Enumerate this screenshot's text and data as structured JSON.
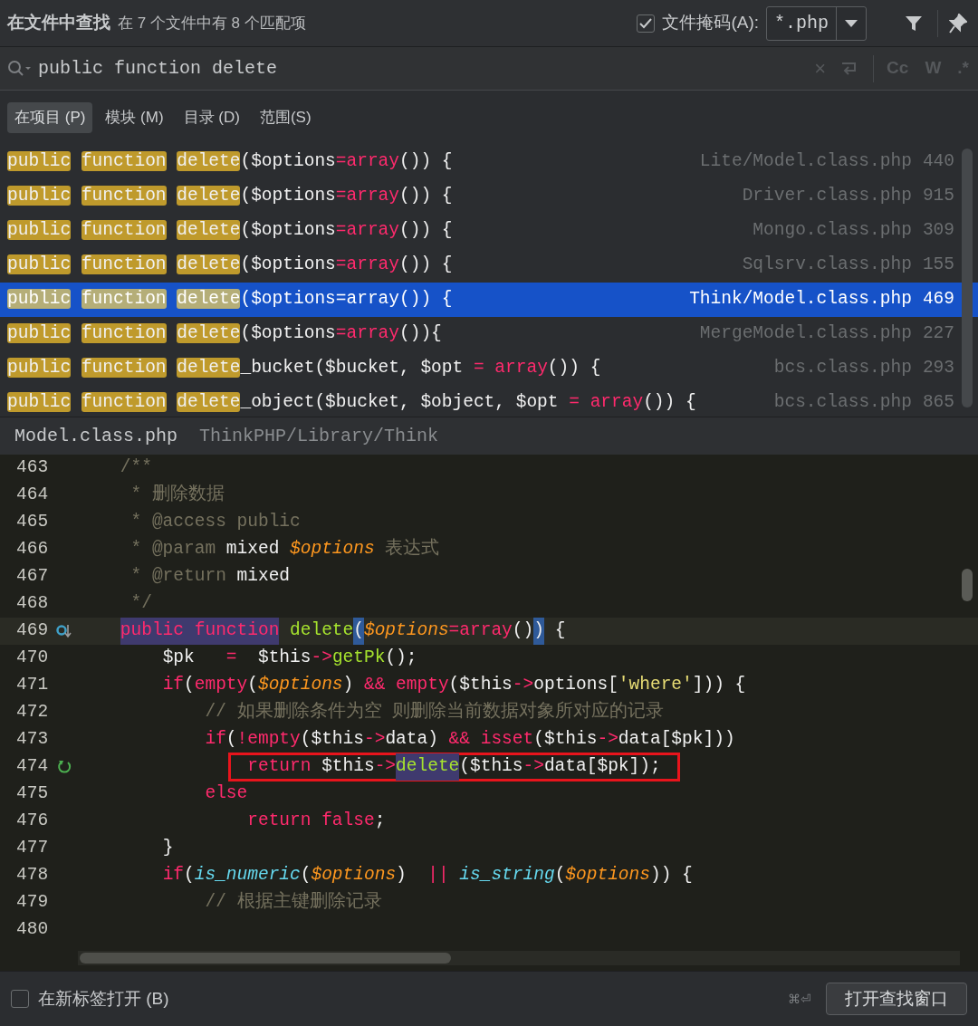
{
  "header": {
    "title": "在文件中查找",
    "summary": "在 7 个文件中有 8 个匹配项",
    "file_mask": {
      "checked": true,
      "label": "文件掩码(A):",
      "value": "*.php"
    }
  },
  "search": {
    "value": "public function delete",
    "clear": "×",
    "options": [
      {
        "label": "Cc",
        "on": false
      },
      {
        "label": "W",
        "on": false
      },
      {
        "label": ".*",
        "on": false
      }
    ]
  },
  "scopes": [
    {
      "label": "在项目 (P)",
      "selected": true
    },
    {
      "label": "模块 (M)",
      "selected": false
    },
    {
      "label": "目录 (D)",
      "selected": false
    },
    {
      "label": "范围(S)",
      "selected": false
    }
  ],
  "results": [
    {
      "selected": false,
      "file": "Lite/Model.class.php",
      "line": "440",
      "tokens": [
        {
          "t": "public",
          "kind": "match"
        },
        {
          "t": " function",
          "kind": "match"
        },
        {
          "t": " delete",
          "kind": "match"
        },
        {
          "t": "($options",
          "kind": "plain"
        },
        {
          "t": "=array",
          "kind": "kw"
        },
        {
          "t": "()) {",
          "kind": "plain"
        }
      ]
    },
    {
      "selected": false,
      "file": "Driver.class.php",
      "line": "915",
      "tokens": [
        {
          "t": "public",
          "kind": "match"
        },
        {
          "t": " function",
          "kind": "match"
        },
        {
          "t": " delete",
          "kind": "match"
        },
        {
          "t": "($options",
          "kind": "plain"
        },
        {
          "t": "=array",
          "kind": "kw"
        },
        {
          "t": "()) {",
          "kind": "plain"
        }
      ]
    },
    {
      "selected": false,
      "file": "Mongo.class.php",
      "line": "309",
      "tokens": [
        {
          "t": "public",
          "kind": "match"
        },
        {
          "t": " function",
          "kind": "match"
        },
        {
          "t": " delete",
          "kind": "match"
        },
        {
          "t": "($options",
          "kind": "plain"
        },
        {
          "t": "=array",
          "kind": "kw"
        },
        {
          "t": "()) {",
          "kind": "plain"
        }
      ]
    },
    {
      "selected": false,
      "file": "Sqlsrv.class.php",
      "line": "155",
      "tokens": [
        {
          "t": "public",
          "kind": "match"
        },
        {
          "t": " function",
          "kind": "match"
        },
        {
          "t": " delete",
          "kind": "match"
        },
        {
          "t": "($options",
          "kind": "plain"
        },
        {
          "t": "=array",
          "kind": "kw"
        },
        {
          "t": "()) {",
          "kind": "plain"
        }
      ]
    },
    {
      "selected": true,
      "file": "Think/Model.class.php",
      "line": "469",
      "tokens": [
        {
          "t": "public",
          "kind": "match"
        },
        {
          "t": " function",
          "kind": "match"
        },
        {
          "t": " delete",
          "kind": "match"
        },
        {
          "t": "($options",
          "kind": "plain"
        },
        {
          "t": "=array",
          "kind": "kw"
        },
        {
          "t": "()) {",
          "kind": "plain"
        }
      ]
    },
    {
      "selected": false,
      "file": "MergeModel.class.php",
      "line": "227",
      "tokens": [
        {
          "t": "public",
          "kind": "match"
        },
        {
          "t": " function",
          "kind": "match"
        },
        {
          "t": " delete",
          "kind": "match"
        },
        {
          "t": "($options",
          "kind": "plain"
        },
        {
          "t": "=array",
          "kind": "kw"
        },
        {
          "t": "()){",
          "kind": "plain"
        }
      ]
    },
    {
      "selected": false,
      "file": "bcs.class.php",
      "line": "293",
      "tokens": [
        {
          "t": "public",
          "kind": "match"
        },
        {
          "t": " function",
          "kind": "match"
        },
        {
          "t": " delete",
          "kind": "match"
        },
        {
          "t": "_bucket($bucket, $opt ",
          "kind": "plain"
        },
        {
          "t": "= array",
          "kind": "kw"
        },
        {
          "t": "()) {",
          "kind": "plain"
        }
      ]
    },
    {
      "selected": false,
      "file": "bcs.class.php",
      "line": "865",
      "tokens": [
        {
          "t": "public",
          "kind": "match"
        },
        {
          "t": " function",
          "kind": "match"
        },
        {
          "t": " delete",
          "kind": "match"
        },
        {
          "t": "_object($bucket, $object, $opt ",
          "kind": "plain"
        },
        {
          "t": "= array",
          "kind": "kw"
        },
        {
          "t": "()) {",
          "kind": "plain"
        }
      ]
    }
  ],
  "preview": {
    "file": "Model.class.php",
    "path": "ThinkPHP/Library/Think",
    "lines": [
      {
        "n": "463",
        "tokens": [
          {
            "t": "    /**",
            "kind": "comment"
          }
        ]
      },
      {
        "n": "464",
        "tokens": [
          {
            "t": "     * 删除数据",
            "kind": "comment"
          }
        ]
      },
      {
        "n": "465",
        "tokens": [
          {
            "t": "     * @access public",
            "kind": "comment"
          }
        ]
      },
      {
        "n": "466",
        "tokens": [
          {
            "t": "     * @param",
            "kind": "comment"
          },
          {
            "t": " mixed ",
            "kind": "plain"
          },
          {
            "t": "$options",
            "kind": "var"
          },
          {
            "t": " 表达式",
            "kind": "comment"
          }
        ]
      },
      {
        "n": "467",
        "tokens": [
          {
            "t": "     * @return",
            "kind": "comment"
          },
          {
            "t": " mixed",
            "kind": "plain"
          }
        ]
      },
      {
        "n": "468",
        "tokens": [
          {
            "t": "     */",
            "kind": "comment"
          }
        ]
      },
      {
        "n": "469",
        "current": true,
        "gutter_icon": {
          "kind": "override"
        },
        "tokens": [
          {
            "t": "    public function",
            "kind": "kw",
            "usage_highlight": true
          },
          {
            "t": " delete",
            "kind": "func"
          },
          {
            "t": "(",
            "kind": "plain",
            "brace_match": true
          },
          {
            "t": "$options",
            "kind": "var"
          },
          {
            "t": "=array",
            "kind": "kw"
          },
          {
            "t": "()",
            "kind": "plain"
          },
          {
            "t": ")",
            "kind": "plain",
            "brace_match": true
          },
          {
            "t": " {",
            "kind": "plain"
          }
        ]
      },
      {
        "n": "470",
        "tokens": [
          {
            "t": "        $pk   ",
            "kind": "plain"
          },
          {
            "t": "=",
            "kind": "kw"
          },
          {
            "t": "  $this",
            "kind": "plain"
          },
          {
            "t": "->",
            "kind": "kw"
          },
          {
            "t": "getPk",
            "kind": "func"
          },
          {
            "t": "();",
            "kind": "plain"
          }
        ]
      },
      {
        "n": "471",
        "tokens": [
          {
            "t": "        if",
            "kind": "kw"
          },
          {
            "t": "(",
            "kind": "plain"
          },
          {
            "t": "empty",
            "kind": "kw"
          },
          {
            "t": "(",
            "kind": "plain"
          },
          {
            "t": "$options",
            "kind": "var"
          },
          {
            "t": ") ",
            "kind": "plain"
          },
          {
            "t": "&& empty",
            "kind": "kw"
          },
          {
            "t": "($this",
            "kind": "plain"
          },
          {
            "t": "->",
            "kind": "kw"
          },
          {
            "t": "options[",
            "kind": "plain"
          },
          {
            "t": "'where'",
            "kind": "string"
          },
          {
            "t": "])) {",
            "kind": "plain"
          }
        ]
      },
      {
        "n": "472",
        "tokens": [
          {
            "t": "            // 如果删除条件为空 则删除当前数据对象所对应的记录",
            "kind": "comment"
          }
        ]
      },
      {
        "n": "473",
        "tokens": [
          {
            "t": "            if",
            "kind": "kw"
          },
          {
            "t": "(",
            "kind": "plain"
          },
          {
            "t": "!empty",
            "kind": "kw"
          },
          {
            "t": "($this",
            "kind": "plain"
          },
          {
            "t": "->",
            "kind": "kw"
          },
          {
            "t": "data) ",
            "kind": "plain"
          },
          {
            "t": "&& isset",
            "kind": "kw"
          },
          {
            "t": "($this",
            "kind": "plain"
          },
          {
            "t": "->",
            "kind": "kw"
          },
          {
            "t": "data[$pk]))",
            "kind": "plain"
          }
        ]
      },
      {
        "n": "474",
        "boxed": true,
        "gutter_icon": {
          "kind": "recursion"
        },
        "tokens": [
          {
            "t": "                return",
            "kind": "kw"
          },
          {
            "t": " $this",
            "kind": "plain"
          },
          {
            "t": "->",
            "kind": "kw"
          },
          {
            "t": "delete",
            "kind": "func",
            "usage_highlight": true
          },
          {
            "t": "($this",
            "kind": "plain"
          },
          {
            "t": "->",
            "kind": "kw"
          },
          {
            "t": "data[$pk]);",
            "kind": "plain"
          }
        ]
      },
      {
        "n": "475",
        "tokens": [
          {
            "t": "            else",
            "kind": "kw"
          }
        ]
      },
      {
        "n": "476",
        "tokens": [
          {
            "t": "                return false",
            "kind": "kw"
          },
          {
            "t": ";",
            "kind": "plain"
          }
        ]
      },
      {
        "n": "477",
        "tokens": [
          {
            "t": "        }",
            "kind": "plain"
          }
        ]
      },
      {
        "n": "478",
        "tokens": [
          {
            "t": "        if",
            "kind": "kw"
          },
          {
            "t": "(",
            "kind": "plain"
          },
          {
            "t": "is_numeric",
            "kind": "builtin"
          },
          {
            "t": "(",
            "kind": "plain"
          },
          {
            "t": "$options",
            "kind": "var"
          },
          {
            "t": ")  ",
            "kind": "plain"
          },
          {
            "t": "||",
            "kind": "kw"
          },
          {
            "t": " is_string",
            "kind": "builtin"
          },
          {
            "t": "(",
            "kind": "plain"
          },
          {
            "t": "$options",
            "kind": "var"
          },
          {
            "t": ")) {",
            "kind": "plain"
          }
        ]
      },
      {
        "n": "479",
        "tokens": [
          {
            "t": "            // 根据主键删除记录",
            "kind": "comment"
          }
        ]
      },
      {
        "n": "480"
      }
    ]
  },
  "footer": {
    "new_tab": {
      "checked": false,
      "label": "在新标签打开 (B)"
    },
    "shortcut": "⌘⏎",
    "button": "打开查找窗口"
  }
}
